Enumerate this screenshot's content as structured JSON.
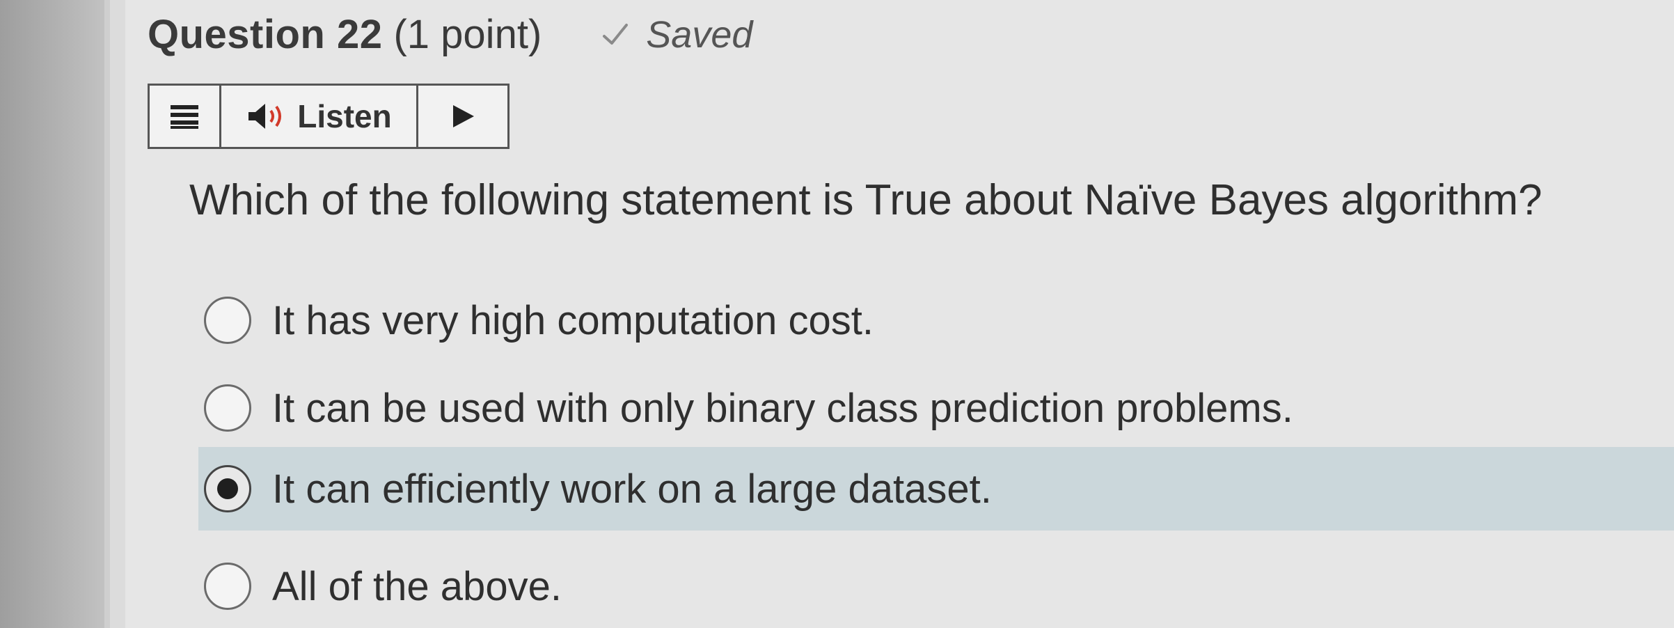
{
  "question": {
    "title": "Question 22",
    "points": "(1 point)",
    "status_icon": "check-icon",
    "status_text": "Saved",
    "text": "Which of the following statement is True about Naïve Bayes algorithm?"
  },
  "listen_bar": {
    "menu_icon": "menu-icon",
    "speaker_icon": "speaker-icon",
    "listen_label": "Listen",
    "play_icon": "play-icon"
  },
  "options": [
    {
      "label": "It has very high computation cost.",
      "selected": false
    },
    {
      "label": "It can be used with only binary class prediction problems.",
      "selected": false
    },
    {
      "label": "It can efficiently work on a large dataset.",
      "selected": true
    },
    {
      "label": "All of the above.",
      "selected": false
    }
  ],
  "colors": {
    "selected_row": "#cbd7db",
    "text": "#2f2f2f"
  }
}
